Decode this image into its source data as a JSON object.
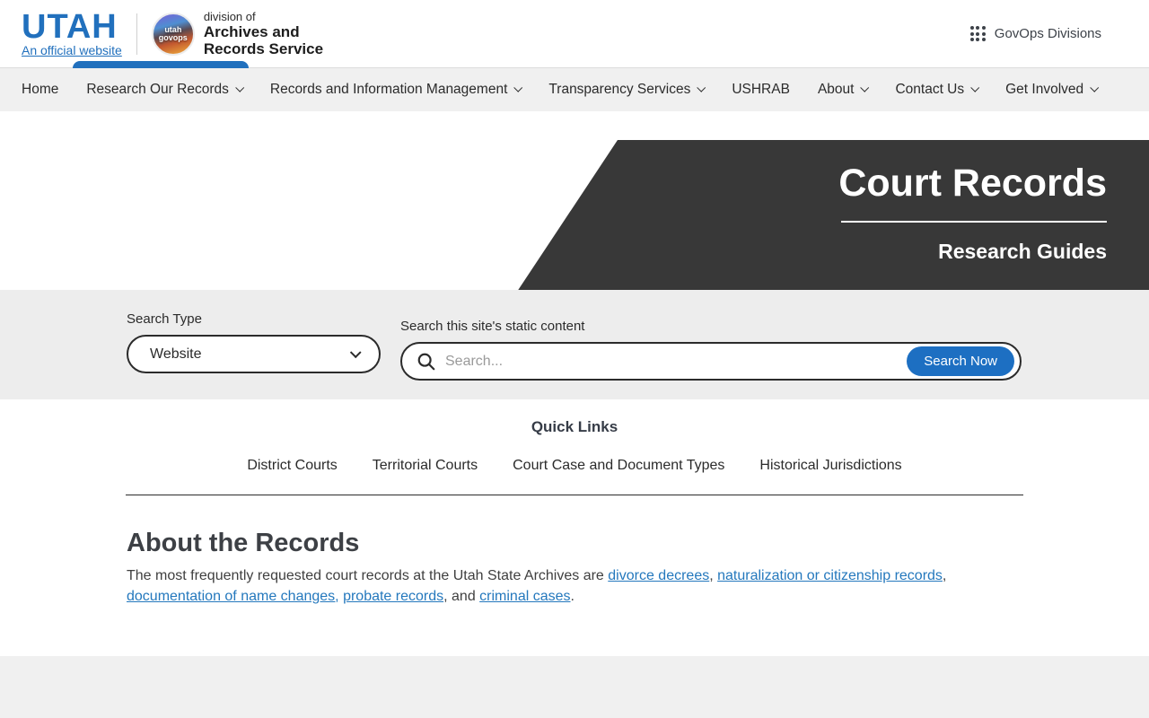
{
  "header": {
    "wordmark": "UTAH",
    "official_label": "An official website",
    "logo_circle_line1": "utah",
    "logo_circle_line2": "govops",
    "division_prefix": "division of",
    "division_name_line1": "Archives and",
    "division_name_line2": "Records Service",
    "govops_label": "GovOps Divisions"
  },
  "nav": {
    "items": [
      {
        "label": "Home",
        "dropdown": false,
        "active": false
      },
      {
        "label": "Research Our Records",
        "dropdown": true,
        "active": true
      },
      {
        "label": "Records and Information Management",
        "dropdown": true,
        "active": false
      },
      {
        "label": "Transparency Services",
        "dropdown": true,
        "active": false
      },
      {
        "label": "USHRAB",
        "dropdown": false,
        "active": false
      },
      {
        "label": "About",
        "dropdown": true,
        "active": false
      },
      {
        "label": "Contact Us",
        "dropdown": true,
        "active": false
      },
      {
        "label": "Get Involved",
        "dropdown": true,
        "active": false
      }
    ]
  },
  "hero": {
    "title": "Court Records",
    "subtitle": "Research Guides"
  },
  "search": {
    "type_label": "Search Type",
    "type_value": "Website",
    "content_label": "Search this site's static content",
    "placeholder": "Search...",
    "button_label": "Search Now"
  },
  "quick_links": {
    "heading": "Quick Links",
    "links": [
      "District Courts",
      "Territorial Courts",
      "Court Case and Document Types",
      "Historical Jurisdictions"
    ]
  },
  "about": {
    "heading": "About the Records",
    "segments": [
      {
        "text": "The most frequently requested court records at the Utah State Archives are ",
        "link": false
      },
      {
        "text": "divorce decrees",
        "link": true
      },
      {
        "text": ", ",
        "link": false
      },
      {
        "text": "naturalization or citizenship records",
        "link": true
      },
      {
        "text": ", ",
        "link": false
      },
      {
        "text": "documentation of name changes,",
        "link": true
      },
      {
        "text": " ",
        "link": false
      },
      {
        "text": "probate records",
        "link": true
      },
      {
        "text": ", and ",
        "link": false
      },
      {
        "text": "criminal cases",
        "link": true
      },
      {
        "text": ".",
        "link": false
      }
    ]
  },
  "colors": {
    "accent_blue": "#2170bd",
    "button_blue": "#1d6fc2",
    "hero_dark": "#383838",
    "nav_gray": "#f0f0f0",
    "band_gray": "#ededed",
    "link_blue": "#2478bd"
  }
}
